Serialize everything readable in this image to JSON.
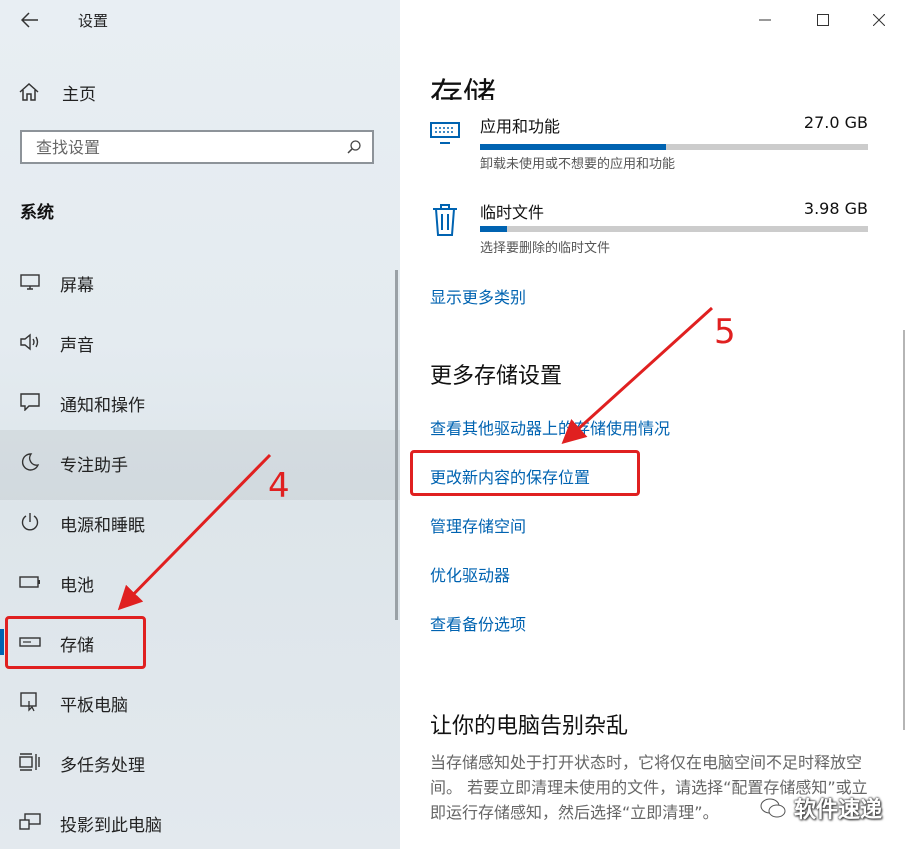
{
  "window": {
    "title": "设置",
    "controls": [
      "minimize",
      "maximize",
      "close"
    ]
  },
  "sidebar": {
    "home_label": "主页",
    "search_placeholder": "查找设置",
    "section_label": "系统",
    "items": [
      {
        "label": "屏幕",
        "icon": "monitor-icon"
      },
      {
        "label": "声音",
        "icon": "speaker-icon"
      },
      {
        "label": "通知和操作",
        "icon": "notification-icon"
      },
      {
        "label": "专注助手",
        "icon": "moon-icon"
      },
      {
        "label": "电源和睡眠",
        "icon": "power-icon"
      },
      {
        "label": "电池",
        "icon": "battery-icon"
      },
      {
        "label": "存储",
        "icon": "storage-drive-icon",
        "selected": true
      },
      {
        "label": "平板电脑",
        "icon": "tablet-icon"
      },
      {
        "label": "多任务处理",
        "icon": "multitask-icon"
      },
      {
        "label": "投影到此电脑",
        "icon": "project-icon"
      }
    ]
  },
  "main": {
    "page_title": "存储",
    "storage_items": [
      {
        "name": "应用和功能",
        "size": "27.0 GB",
        "description": "卸载未使用或不想要的应用和功能",
        "usage_fraction": 0.48,
        "icon": "apps-keyboard-icon"
      },
      {
        "name": "临时文件",
        "size": "3.98 GB",
        "description": "选择要删除的临时文件",
        "usage_fraction": 0.07,
        "icon": "trash-icon"
      }
    ],
    "show_more_link": "显示更多类别",
    "more_settings": {
      "heading": "更多存储设置",
      "links": [
        "查看其他驱动器上的存储使用情况",
        "更改新内容的保存位置",
        "管理存储空间",
        "优化驱动器",
        "查看备份选项"
      ]
    },
    "declutter": {
      "heading": "让你的电脑告别杂乱",
      "text": "当存储感知处于打开状态时，它将仅在电脑空间不足时释放空间。 若要立即清理未使用的文件，请选择“配置存储感知”或立即运行存储感知，然后选择“立即清理”。"
    }
  },
  "annotations": {
    "step4": "4",
    "step5": "5",
    "color": "#e02020"
  },
  "watermark": "软件速递",
  "colors": {
    "accent": "#0063b1",
    "annotation": "#e02020"
  }
}
